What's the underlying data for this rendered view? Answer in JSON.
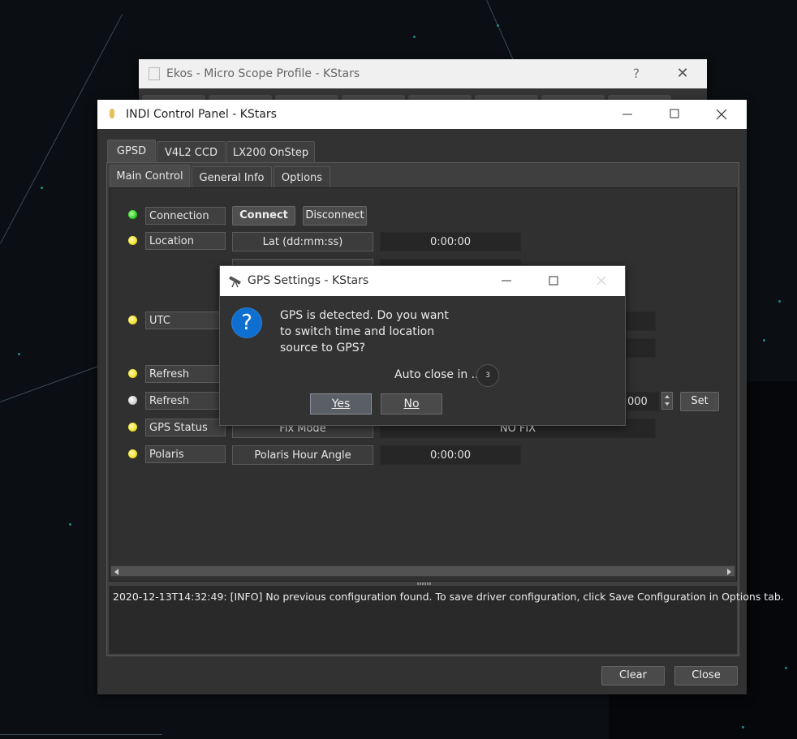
{
  "ekos_window": {
    "title": "Ekos - Micro Scope Profile - KStars",
    "help_glyph": "?",
    "close_glyph": "✕"
  },
  "indi_window": {
    "title": "INDI Control Panel - KStars",
    "device_tabs": [
      "GPSD",
      "V4L2 CCD",
      "LX200 OnStep"
    ],
    "group_tabs": [
      "Main Control",
      "General Info",
      "Options"
    ],
    "properties": {
      "connection": {
        "label": "Connection",
        "connect": "Connect",
        "disconnect": "Disconnect"
      },
      "location": {
        "label": "Location",
        "lat_label": "Lat (dd:mm:ss)",
        "lat_value": "0:00:00"
      },
      "utc": {
        "label": "UTC"
      },
      "refresh1": {
        "label": "Refresh"
      },
      "refresh2": {
        "label": "Refresh",
        "value_fragment": "000",
        "set": "Set"
      },
      "gps_status": {
        "label": "GPS Status",
        "element": "Fix Mode",
        "value": "NO FIX"
      },
      "polaris": {
        "label": "Polaris",
        "element": "Polaris Hour Angle",
        "value": "0:00:00"
      }
    },
    "log": "2020-12-13T14:32:49: [INFO] No previous configuration found. To save driver configuration, click Save Configuration in Options tab.",
    "buttons": {
      "clear": "Clear",
      "close": "Close"
    }
  },
  "gps_dialog": {
    "title": "GPS Settings - KStars",
    "message_line1": "GPS is detected. Do you want",
    "message_line2": "to switch time and location",
    "message_line3": "source to GPS?",
    "auto_close": "Auto close in ...",
    "countdown": "3",
    "yes_label": "Yes",
    "no_label": "No"
  },
  "colors": {
    "sky": "#0b0e12",
    "window_bg": "#323232",
    "accent_blue": "#0f6fd0",
    "led_green": "#2fd02a",
    "led_yellow": "#f2e22b"
  }
}
